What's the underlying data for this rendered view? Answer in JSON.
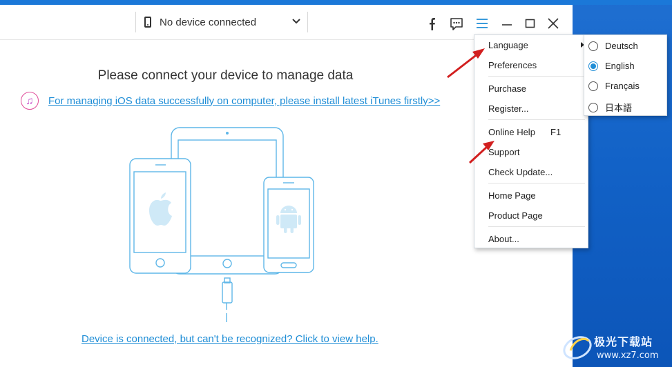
{
  "device": {
    "label": "No device connected"
  },
  "toolbar": {
    "facebook_icon": "facebook-icon",
    "feedback_icon": "chat-icon",
    "menu_icon": "hamburger-icon",
    "min_icon": "minimize-icon",
    "max_icon": "maximize-icon",
    "close_icon": "close-icon"
  },
  "main": {
    "title": "Please connect your device to manage data",
    "itunes_link": "For managing iOS data successfully on computer, please install latest iTunes firstly>>",
    "help_link": "Device is connected, but can't be recognized? Click to view help."
  },
  "menu": {
    "language": "Language",
    "preferences": "Preferences",
    "purchase": "Purchase",
    "register": "Register...",
    "online_help": "Online Help",
    "online_help_accel": "F1",
    "support": "Support",
    "check_update": "Check Update...",
    "home_page": "Home Page",
    "product_page": "Product Page",
    "about": "About..."
  },
  "languages": [
    {
      "label": "Deutsch",
      "selected": false
    },
    {
      "label": "English",
      "selected": true
    },
    {
      "label": "Français",
      "selected": false
    },
    {
      "label": "日本語",
      "selected": false
    }
  ],
  "watermark": {
    "text": "极光下载站",
    "url": "www.xz7.com"
  },
  "colors": {
    "accent": "#1e8dd6",
    "illustration": "#5fb7e8",
    "arrow": "#d21f1f",
    "desktop": "#1262c7"
  }
}
